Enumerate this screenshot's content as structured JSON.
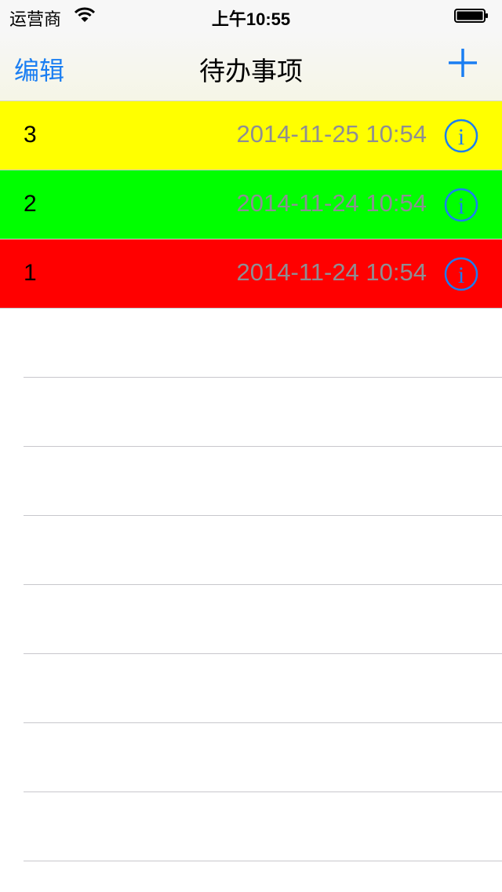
{
  "status_bar": {
    "carrier": "运营商",
    "time": "上午10:55",
    "wifi_icon": "wifi-icon",
    "battery_icon": "battery-icon"
  },
  "nav": {
    "edit_label": "编辑",
    "title": "待办事项",
    "add_icon": "plus-icon",
    "accent_color": "#1a7ef2"
  },
  "todos": [
    {
      "name": "3",
      "date": "2014-11-25 10:54",
      "color": "#ffff00",
      "info_icon": "info-icon"
    },
    {
      "name": "2",
      "date": "2014-11-24 10:54",
      "color": "#00ff00",
      "info_icon": "info-icon"
    },
    {
      "name": "1",
      "date": "2014-11-24 10:54",
      "color": "#ff0000",
      "info_icon": "info-icon"
    }
  ],
  "colors": {
    "date_text": "#8e8e93",
    "separator": "#c8c7cc",
    "info_button": "#1a7ef2"
  }
}
